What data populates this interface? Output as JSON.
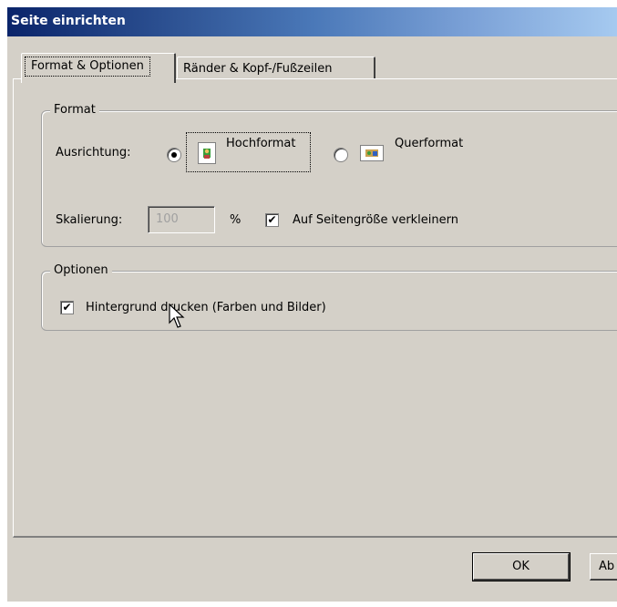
{
  "window": {
    "title": "Seite einrichten"
  },
  "tabs": [
    {
      "label": "Format & Optionen",
      "active": true
    },
    {
      "label": "Ränder & Kopf-/Fußzeilen",
      "active": false
    }
  ],
  "format_group": {
    "legend": "Format",
    "orientation_label": "Ausrichtung:",
    "portrait_label": "Hochformat",
    "landscape_label": "Querformat",
    "selected_orientation": "Hochformat",
    "scale_label": "Skalierung:",
    "scale_value": "100",
    "scale_unit": "%",
    "shrink_label": "Auf Seitengröße verkleinern",
    "shrink_checked": true
  },
  "options_group": {
    "legend": "Optionen",
    "print_bg_label": "Hintergrund drucken (Farben und Bilder)",
    "print_bg_checked": true
  },
  "buttons": {
    "ok_label": "OK",
    "cancel_label": "Ab"
  },
  "icons": {
    "portrait": "portrait-page-icon",
    "landscape": "landscape-page-icon",
    "cursor": "mouse-pointer-icon"
  }
}
